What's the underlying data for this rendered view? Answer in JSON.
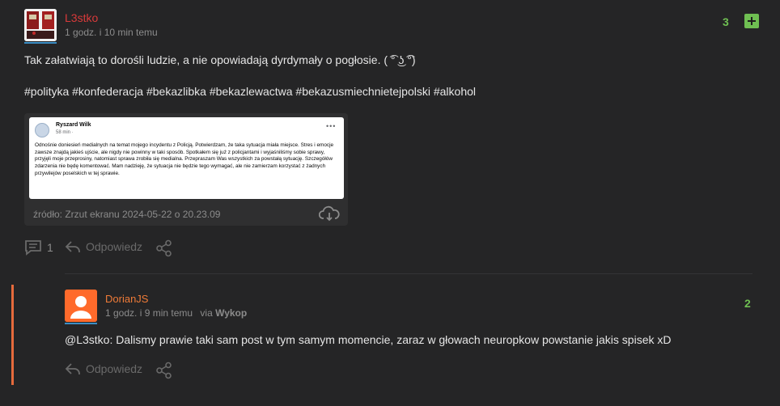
{
  "post": {
    "author": "L3stko",
    "time": "1 godz. i 10 min temu",
    "votes": "3",
    "body": "Tak załatwiają to dorośli ludzie, a nie opowiadają dyrdymały o pogłosie. ( ͡° ͜ʖ ͡°)",
    "tags": "#polityka #konfederacja #bekazlibka #bekazlewactwa #bekazusmiechnietejpolski #alkohol",
    "embed": {
      "fb_name": "Ryszard Wilk",
      "fb_meta": "58 min ·",
      "fb_text": "Odnośnie doniesień medialnych na temat mojego incydentu z Policją. Potwierdzam, że taka sytuacja miała miejsce. Stres i emocje zawsze znajdą jakieś ujście, ale nigdy nie powinny w taki sposób. Spotkałem się już z policjantami i wyjaśniliśmy sobie sprawy, przyjęli moje przeprosiny, natomiast sprawa zrobiła się medialna. Przepraszam Was wszystkich za powstałą sytuację. Szczegółów zdarzenia nie będę komentować. Mam nadzieję, że sytuacja nie będzie tego wymagać, ale nie zamierzam korzystać z żadnych przywilejów poselskich w tej sprawie.",
      "source": "źródło: Zrzut ekranu 2024-05-22 o 20.23.09"
    },
    "comments_count": "1",
    "reply_label": "Odpowiedz"
  },
  "reply": {
    "author": "DorianJS",
    "time": "1 godz. i 9 min temu",
    "via_prefix": "via",
    "via_app": "Wykop",
    "votes": "2",
    "mention": "@L3stko:",
    "body": " Dalismy prawie taki sam post w tym samym momencie, zaraz w głowach neuropkow powstanie jakis spisek xD",
    "reply_label": "Odpowiedz"
  },
  "colors": {
    "author_red": "#d93a3a",
    "author_orange": "#ef7b38",
    "vote_green": "#6fbf52",
    "accent_blue": "#3b8ec4",
    "reply_bar": "#e66b3c"
  }
}
